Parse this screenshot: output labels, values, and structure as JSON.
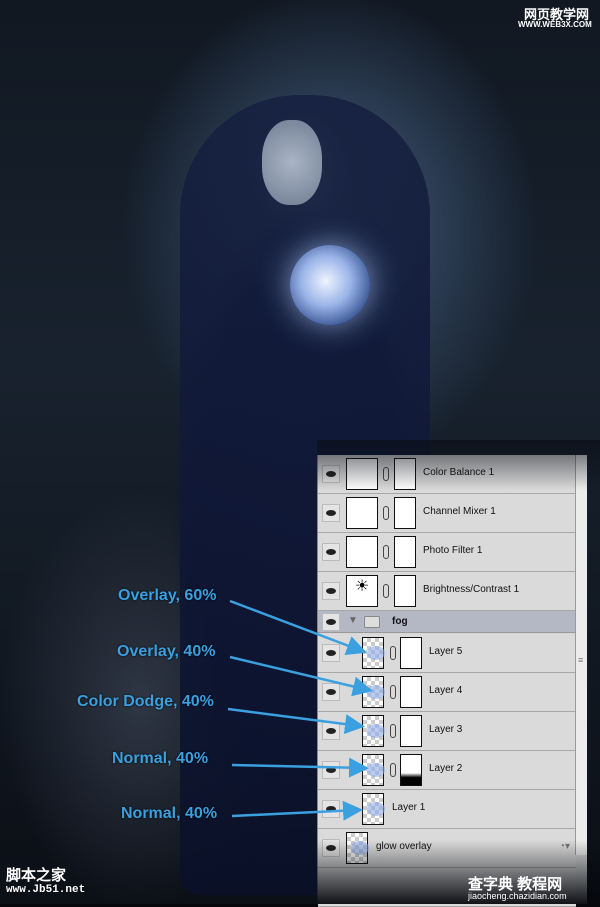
{
  "layers_panel": {
    "layers": [
      {
        "name": "Color Balance 1",
        "type": "adjustment",
        "icon": "scale-icon"
      },
      {
        "name": "Channel Mixer 1",
        "type": "adjustment",
        "icon": "channel-mixer-icon"
      },
      {
        "name": "Photo Filter 1",
        "type": "adjustment",
        "icon": "camera-icon"
      },
      {
        "name": "Brightness/Contrast 1",
        "type": "adjustment",
        "icon": "sun-icon"
      }
    ],
    "group": {
      "name": "fog",
      "expanded": true
    },
    "group_layers": [
      {
        "name": "Layer 5",
        "mask": true
      },
      {
        "name": "Layer 4",
        "mask": true
      },
      {
        "name": "Layer 3",
        "mask": true
      },
      {
        "name": "Layer 2",
        "mask": true
      },
      {
        "name": "Layer 1",
        "mask": false
      }
    ],
    "bottom_layer": {
      "name": "glow overlay"
    }
  },
  "annotations": [
    "Overlay, 60%",
    "Overlay, 40%",
    "Color Dodge, 40%",
    "Normal, 40%",
    "Normal, 40%"
  ],
  "colors": {
    "annotation": "#3aa0e0",
    "panel": "#d6d6d6",
    "group_row": "#b4b8c4"
  },
  "watermarks": {
    "top_right_cn": "网页教学网",
    "top_right_url": "WWW.WEB3X.COM",
    "bottom_left_cn": "脚本之家",
    "bottom_left_url": "www.Jb51.net",
    "bottom_right_cn": "查字典 教程网",
    "bottom_right_url": "jiaocheng.chazidian.com"
  }
}
